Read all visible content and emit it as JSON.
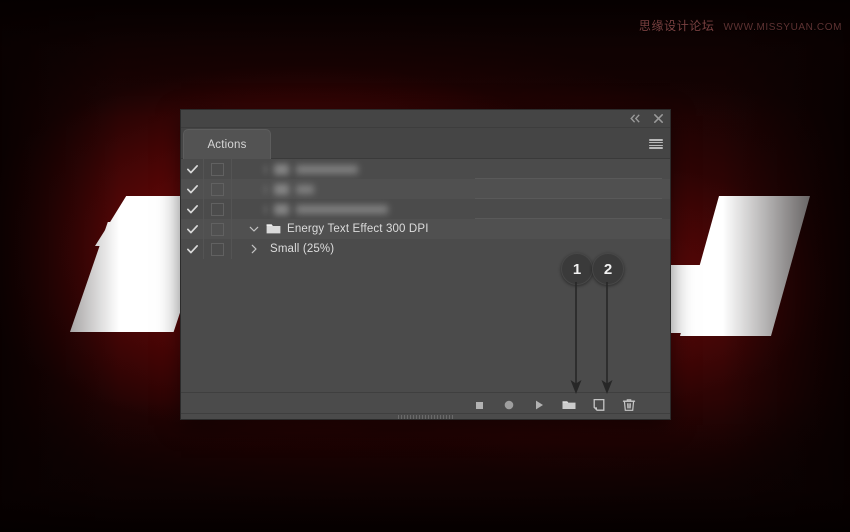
{
  "watermark": {
    "cn": "思缘设计论坛",
    "url": "WWW.MISSYUAN.COM"
  },
  "panel": {
    "title": "Actions",
    "titlebar": {
      "collapse_icon": "double-chevron-left-icon",
      "close_icon": "close-icon",
      "menu_icon": "hamburger-menu-icon"
    },
    "rows": [
      {
        "id": "row-1",
        "checked": true,
        "toggle": false,
        "label": "",
        "redacted": true,
        "blur_bar_width": 62,
        "separator": true,
        "shaded": false,
        "kind": "action-set"
      },
      {
        "id": "row-2",
        "checked": true,
        "toggle": false,
        "label": "",
        "redacted": true,
        "blur_bar_width": 18,
        "separator": true,
        "shaded": true,
        "kind": "action-set"
      },
      {
        "id": "row-3",
        "checked": true,
        "toggle": false,
        "label": "",
        "redacted": true,
        "blur_bar_width": 92,
        "separator": true,
        "shaded": false,
        "kind": "action-set"
      },
      {
        "id": "row-4",
        "checked": true,
        "toggle": false,
        "label": "Energy Text Effect 300 DPI",
        "redacted": false,
        "separator": false,
        "shaded": true,
        "kind": "action-set",
        "expanded": true,
        "folder": true
      },
      {
        "id": "row-5",
        "checked": true,
        "toggle": false,
        "label": "Small (25%)",
        "redacted": false,
        "separator": false,
        "shaded": false,
        "kind": "action",
        "expanded": false,
        "folder": false
      }
    ],
    "footer_buttons": [
      {
        "id": "stop",
        "label": "Stop playing/recording",
        "icon": "stop-square-icon"
      },
      {
        "id": "record",
        "label": "Begin recording",
        "icon": "record-circle-icon"
      },
      {
        "id": "play",
        "label": "Play selection",
        "icon": "play-triangle-icon"
      },
      {
        "id": "new-set",
        "label": "Create new set",
        "icon": "new-folder-icon"
      },
      {
        "id": "new-action",
        "label": "Create new action",
        "icon": "new-page-icon"
      },
      {
        "id": "delete",
        "label": "Delete",
        "icon": "trash-icon"
      }
    ]
  },
  "callouts": [
    {
      "number": "1",
      "target": "new-set"
    },
    {
      "number": "2",
      "target": "new-action"
    }
  ],
  "colors": {
    "panel_bg": "#4b4b4b",
    "panel_header": "#454545",
    "tab_bg": "#535353",
    "row_alt": "#505050",
    "text": "#dcdcdc",
    "backdrop_red": "#8a0c0c",
    "callout_bg": "#3a3a3a"
  }
}
